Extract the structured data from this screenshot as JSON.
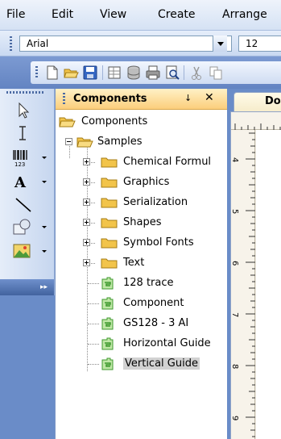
{
  "menu": [
    "File",
    "Edit",
    "View",
    "Create",
    "Arrange"
  ],
  "font_bar": {
    "font": "Arial",
    "size": "12"
  },
  "toolbar": {
    "icons": [
      "new-document-icon",
      "open-folder-icon",
      "save-icon",
      "page-setup-icon",
      "database-icon",
      "print-icon",
      "print-preview-icon",
      "cut-icon",
      "copy-icon"
    ]
  },
  "tools": [
    "pointer-tool-icon",
    "text-cursor-tool-icon",
    "barcode-tool-icon",
    "text-tool-icon",
    "line-tool-icon",
    "shape-tool-icon",
    "image-tool-icon"
  ],
  "panel": {
    "title": "Components",
    "pin": "↓",
    "close": "✕",
    "tree": {
      "root": "Components",
      "samples": "Samples",
      "folders": [
        "Chemical Formul",
        "Graphics",
        "Serialization",
        "Shapes",
        "Symbol Fonts",
        "Text"
      ],
      "components": [
        "128 trace",
        "Component",
        "GS128 - 3 AI",
        "Horizontal Guide",
        "Vertical Guide"
      ],
      "selected": "Vertical Guide"
    }
  },
  "document": {
    "tab_label": "Doc",
    "ruler_numbers": [
      "4",
      "5",
      "6",
      "7",
      "8",
      "9"
    ]
  },
  "colors": {
    "accent_header": "#fbce7c",
    "workspace": "#6a8cc8",
    "folder": "#f2c44a",
    "component_green": "#3f9a2e"
  }
}
